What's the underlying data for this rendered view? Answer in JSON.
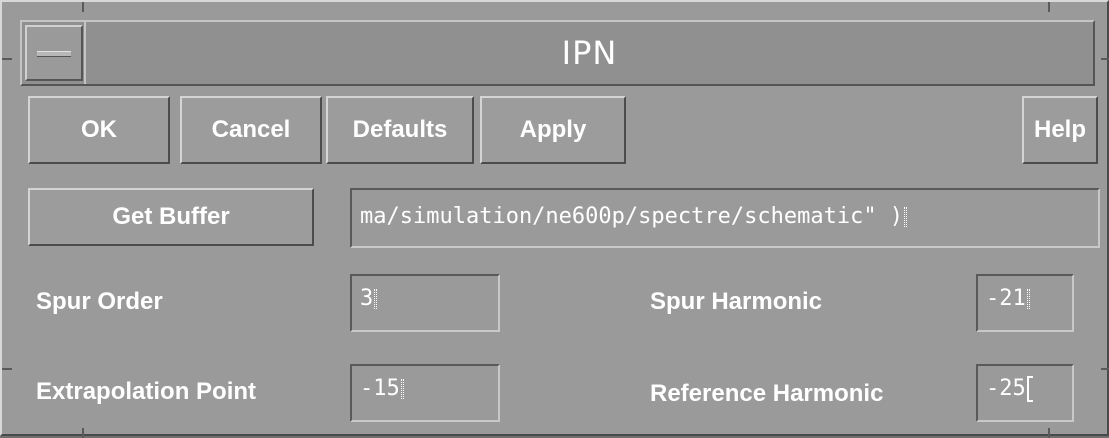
{
  "window": {
    "title": "IPN"
  },
  "buttons": {
    "ok": "OK",
    "cancel": "Cancel",
    "defaults": "Defaults",
    "apply": "Apply",
    "help": "Help",
    "get_buffer": "Get Buffer"
  },
  "fields": {
    "buffer": {
      "value": "ma/simulation/ne600p/spectre/schematic\" )"
    },
    "spur_order": {
      "label": "Spur Order",
      "value": "3"
    },
    "spur_harmonic": {
      "label": "Spur Harmonic",
      "value": "-21"
    },
    "extrapolation_point": {
      "label": "Extrapolation Point",
      "value": "-15"
    },
    "reference_harmonic": {
      "label": "Reference Harmonic",
      "value": "-25"
    }
  },
  "colors": {
    "background": "#9a9a9a",
    "text": "#ffffff"
  }
}
